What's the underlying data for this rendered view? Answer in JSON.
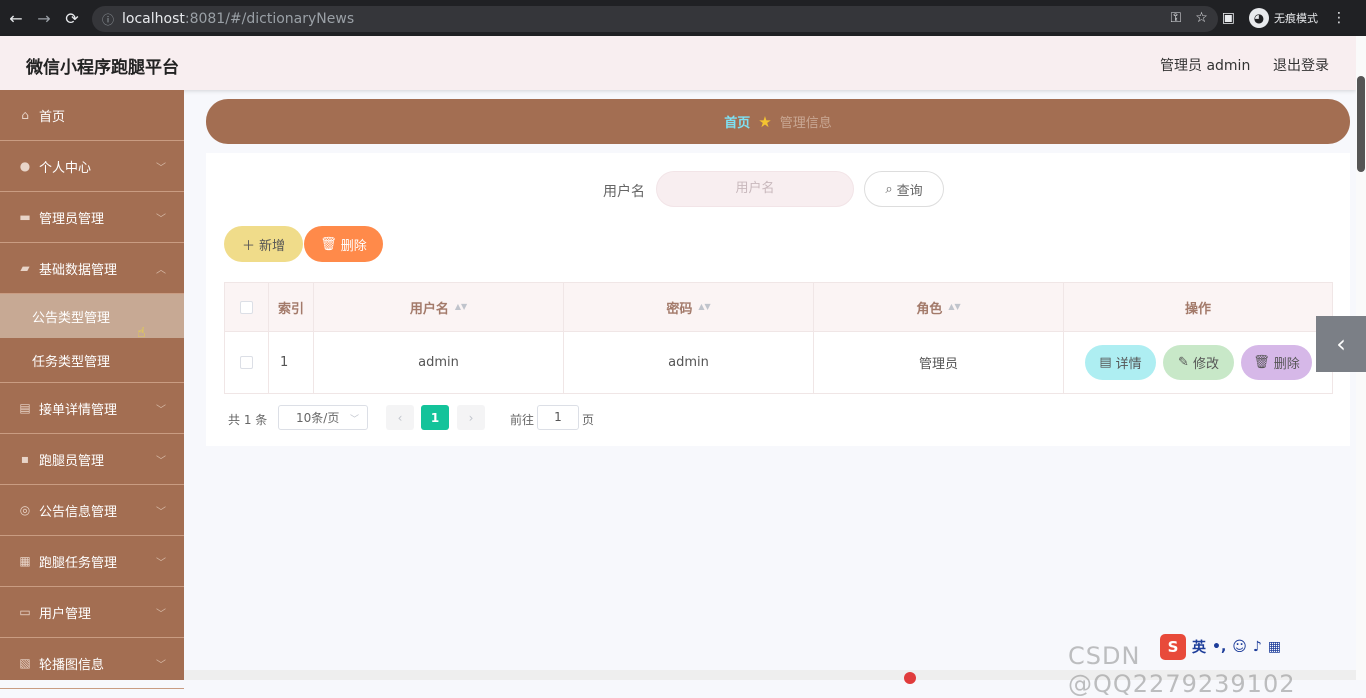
{
  "browser": {
    "url_host": "localhost",
    "url_path": ":8081/#/dictionaryNews",
    "incognito_label": "无痕模式"
  },
  "header": {
    "title": "微信小程序跑腿平台",
    "user": "管理员 admin",
    "logout": "退出登录"
  },
  "sidebar": {
    "items": [
      {
        "label": "首页",
        "icon": "home-icon"
      },
      {
        "label": "个人中心",
        "icon": "user-icon"
      },
      {
        "label": "管理员管理",
        "icon": "monitor-icon"
      },
      {
        "label": "基础数据管理",
        "icon": "briefcase-icon"
      },
      {
        "label": "接单详情管理",
        "icon": "clipboard-icon"
      },
      {
        "label": "跑腿员管理",
        "icon": "camera-icon"
      },
      {
        "label": "公告信息管理",
        "icon": "compass-icon"
      },
      {
        "label": "跑腿任务管理",
        "icon": "grid-icon"
      },
      {
        "label": "用户管理",
        "icon": "chat-icon"
      },
      {
        "label": "轮播图信息",
        "icon": "image-icon"
      }
    ],
    "subitems": [
      {
        "label": "公告类型管理"
      },
      {
        "label": "任务类型管理"
      }
    ]
  },
  "breadcrumb": {
    "home": "首页",
    "current": "管理信息"
  },
  "search": {
    "label": "用户名",
    "placeholder": "用户名",
    "button": "查询"
  },
  "actions": {
    "add": "新增",
    "delete": "删除"
  },
  "table": {
    "headers": [
      "索引",
      "用户名",
      "密码",
      "角色",
      "操作"
    ],
    "rows": [
      {
        "index": "1",
        "username": "admin",
        "password": "admin",
        "role": "管理员"
      }
    ],
    "row_actions": {
      "detail": "详情",
      "edit": "修改",
      "delete": "删除"
    }
  },
  "pagination": {
    "total": "共 1 条",
    "page_size": "10条/页",
    "current_page": "1",
    "goto_label": "前往",
    "goto_value": "1",
    "goto_suffix": "页"
  },
  "watermark": "CSDN @QQ2279239102",
  "colors": {
    "sidebar": "#a36e52",
    "header": "#f8eef0",
    "active_page": "#13c39a",
    "add_button": "#f0dc8a",
    "delete_button": "#ff8a4a"
  }
}
